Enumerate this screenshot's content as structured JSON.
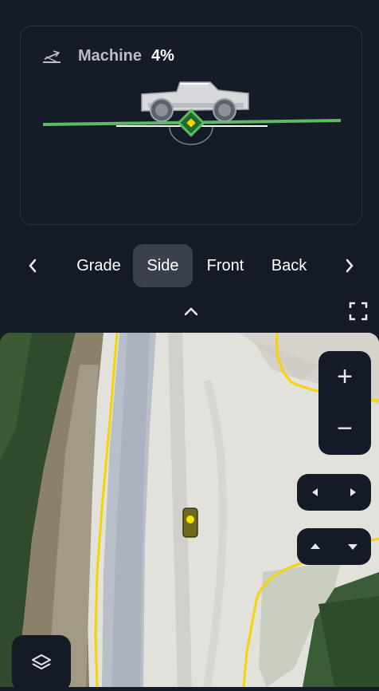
{
  "machine_card": {
    "title": "Machine",
    "value": "4%",
    "icon": "slope-icon",
    "line_color": "#5dbb63"
  },
  "view_tabs": {
    "items": [
      "Grade",
      "Side",
      "Front",
      "Back"
    ],
    "selected": "Side",
    "prev_icon": "chevron-left-icon",
    "next_icon": "chevron-right-icon"
  },
  "toolbar": {
    "collapse_icon": "chevron-up-icon",
    "fullscreen_icon": "fullscreen-icon"
  },
  "map": {
    "zoom_in_label": "+",
    "zoom_out_label": "−",
    "boundary_color": "#f5d400",
    "layers_icon": "layers-icon"
  }
}
